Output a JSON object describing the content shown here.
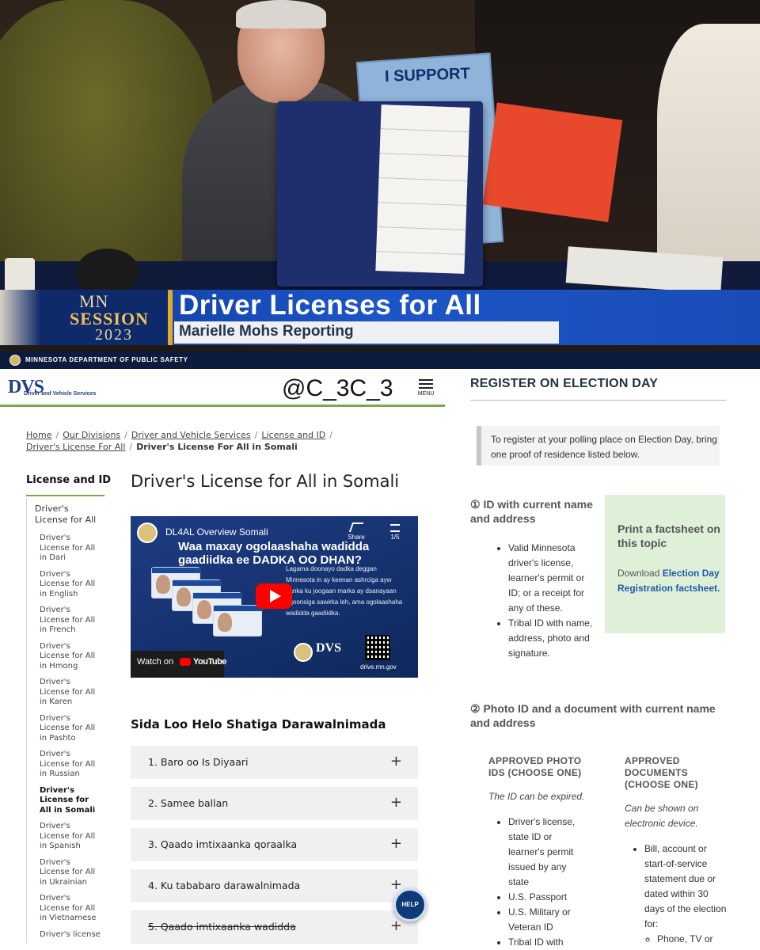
{
  "video": {
    "sign_text": "I SUPPORT",
    "logo_mn": "MN",
    "logo_session": "SESSION",
    "logo_year": "2023",
    "headline": "Driver Licenses for All",
    "reporter": "Marielle Mohs Reporting"
  },
  "dps_bar": {
    "text": "MINNESOTA DEPARTMENT OF PUBLIC SAFETY"
  },
  "dvs": {
    "logo": "DVS",
    "logo_sub": "Driver and Vehicle Services",
    "handle": "@C_3C_3",
    "menu_label": "MENU"
  },
  "breadcrumb": {
    "home": "Home",
    "divisions": "Our Divisions",
    "dvs": "Driver and Vehicle Services",
    "license": "License and ID",
    "dlfa": "Driver's License For All",
    "current": "Driver's License For All in Somali"
  },
  "sidebar": {
    "title": "License and ID",
    "main_item": "Driver's License for All",
    "items": [
      "Driver's License for All in Dari",
      "Driver's License for All in English",
      "Driver's License for All in French",
      "Driver's License for All in Hmong",
      "Driver's License for All in Karen",
      "Driver's License for All in Pashto",
      "Driver's License for All in Russian",
      "Driver's License for All in Somali",
      "Driver's License for All in Spanish",
      "Driver's License for All in Ukrainian",
      "Driver's License for All in Vietnamese",
      "Driver's license"
    ]
  },
  "main": {
    "title": "Driver's License for All in Somali",
    "video": {
      "title": "DL4AL Overview Somali",
      "overlay_title": "Waa maxay ogolaashaha wadidda",
      "overlay_title_2": "gaadiidka ee DADKA OO DHAN?",
      "body": "Lagama doonayo dadka deggan Minnesota in ay keenan ashrciga ayw danka ku joogaan marka ay dsanayaan aqoonsiga sawirka leh, ama ogolaashaha wadidda gaadiidka.",
      "share_label": "Share",
      "playlist_count": "1/5",
      "watch_on": "Watch on",
      "youtube": "YouTube",
      "dvs_logo": "DVS",
      "url": "drive.mn.gov"
    },
    "accordion_heading": "Sida Loo Helo Shatiga Darawalnimada",
    "accordion": [
      {
        "label": "1. Baro oo Is Diyaari",
        "icon": "+"
      },
      {
        "label": "2. Samee ballan",
        "icon": "+"
      },
      {
        "label": "3. Qaado imtixaanka qoraalka",
        "icon": "+"
      },
      {
        "label": "4. Ku tababaro darawalnimada",
        "icon": "+"
      },
      {
        "label": "5. Qaado imtixaanka wadidda",
        "icon": "+"
      }
    ],
    "help_label": "HELP"
  },
  "right": {
    "title": "REGISTER ON ELECTION DAY",
    "notice": "To register at your polling place on Election Day, bring one proof of residence listed below.",
    "section1_title": "① ID with current name and address",
    "section1_items": [
      "Valid Minnesota driver's license, learner's permit or ID; or a receipt for any of these.",
      "Tribal ID with name, address, photo and signature."
    ],
    "factsheet_title": "Print a factsheet on this topic",
    "factsheet_prefix": "Download ",
    "factsheet_link": "Election Day Registration factsheet.",
    "section2_title": "② Photo ID and a document with current name and address",
    "photo_ids_head": "APPROVED PHOTO IDS (CHOOSE ONE)",
    "photo_ids_note": "The ID can be expired.",
    "photo_ids_items": [
      "Driver's license, state ID or learner's permit issued by any state",
      "U.S. Passport",
      "U.S. Military or Veteran ID",
      "Tribal ID with"
    ],
    "docs_head": "APPROVED DOCUMENTS (CHOOSE ONE)",
    "docs_note": "Can be shown on electronic device.",
    "docs_items": [
      "Bill, account or start-of-service statement due or dated within 30 days of the election for:"
    ],
    "docs_subitems": [
      "Phone, TV or"
    ]
  }
}
